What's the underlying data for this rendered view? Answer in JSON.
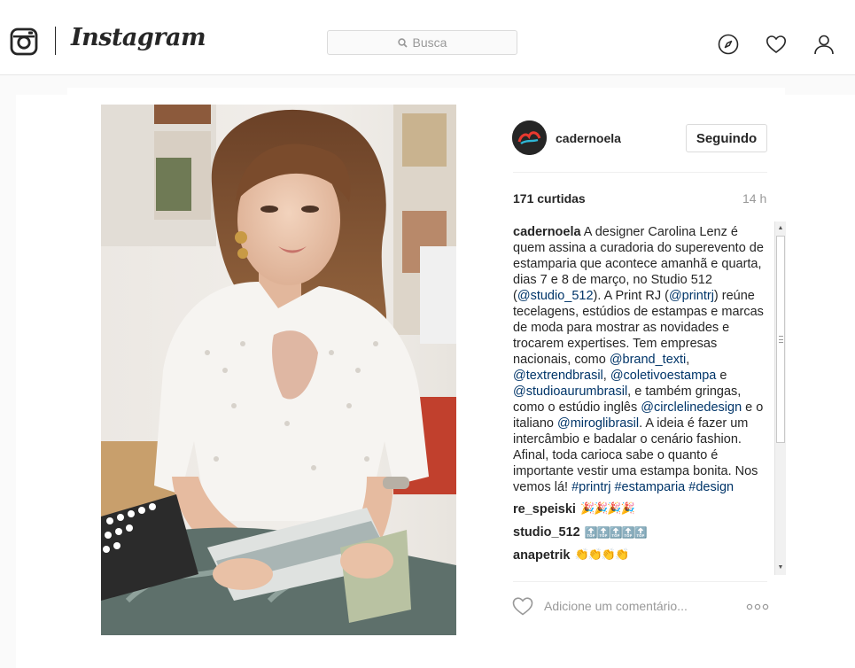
{
  "nav": {
    "brand": "Instagram",
    "search_placeholder": "Busca",
    "icons": [
      "instagram-glyph-icon",
      "search-icon",
      "compass-icon",
      "heart-icon",
      "profile-icon"
    ]
  },
  "post": {
    "author": "cadernoela",
    "follow_label": "Seguindo",
    "likes": "171 curtidas",
    "time": "14 h",
    "caption": {
      "username": "cadernoela",
      "parts": [
        {
          "t": "text",
          "v": " A designer Carolina Lenz é quem assina a curadoria do superevento de estamparia que acontece amanhã e quarta, dias 7 e 8 de março, no Studio 512 ("
        },
        {
          "t": "link",
          "v": "@studio_512"
        },
        {
          "t": "text",
          "v": "). A Print RJ ("
        },
        {
          "t": "link",
          "v": "@printrj"
        },
        {
          "t": "text",
          "v": ") reúne tecelagens, estúdios de estampas e marcas de moda para mostrar as novidades e trocarem expertises. Tem empresas nacionais, como "
        },
        {
          "t": "link",
          "v": "@brand_texti"
        },
        {
          "t": "text",
          "v": ", "
        },
        {
          "t": "link",
          "v": "@textrendbrasil"
        },
        {
          "t": "text",
          "v": ", "
        },
        {
          "t": "link",
          "v": "@coletivoestampa"
        },
        {
          "t": "text",
          "v": " e "
        },
        {
          "t": "link",
          "v": "@studioaurumbrasil"
        },
        {
          "t": "text",
          "v": ", e também gringas, como o estúdio inglês "
        },
        {
          "t": "link",
          "v": "@circlelinedesign"
        },
        {
          "t": "text",
          "v": " e o italiano "
        },
        {
          "t": "link",
          "v": "@miroglibrasil"
        },
        {
          "t": "text",
          "v": ". A ideia é fazer um intercâmbio e badalar o cenário fashion. Afinal, toda carioca sabe o quanto é importante vestir uma estampa bonita. Nos vemos lá! "
        },
        {
          "t": "link",
          "v": "#printrj"
        },
        {
          "t": "text",
          "v": " "
        },
        {
          "t": "link",
          "v": "#estamparia"
        },
        {
          "t": "text",
          "v": " "
        },
        {
          "t": "link",
          "v": "#design"
        }
      ]
    },
    "comments": [
      {
        "user": "re_speiski",
        "text": "🎉🎉🎉🎉",
        "kind": "party"
      },
      {
        "user": "studio_512",
        "text": "🔝🔝🔝🔝🔝",
        "kind": "up"
      },
      {
        "user": "anapetrik",
        "text": "👏👏👏👏",
        "kind": "clap"
      }
    ],
    "comment_placeholder": "Adicione um comentário...",
    "colors": {
      "link": "#003569",
      "muted": "#999999",
      "text": "#262626",
      "border": "#dbdbdb"
    }
  }
}
